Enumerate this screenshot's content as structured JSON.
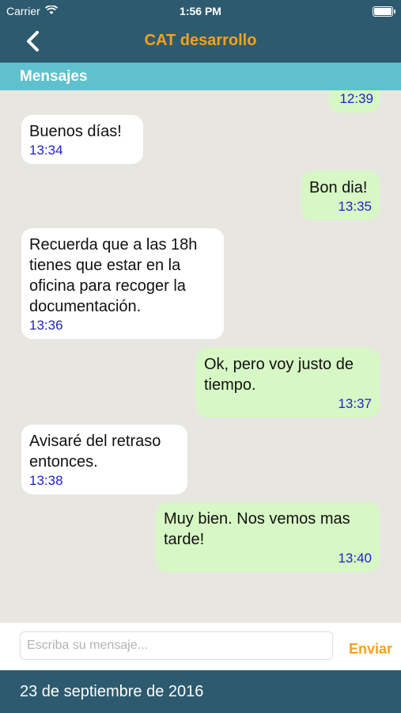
{
  "status_bar": {
    "carrier": "Carrier",
    "time": "1:56 PM"
  },
  "nav": {
    "title": "CAT desarrollo"
  },
  "section": {
    "label": "Mensajes"
  },
  "messages": [
    {
      "direction": "out",
      "text": "",
      "time": "12:39"
    },
    {
      "direction": "in",
      "text": "Buenos días!",
      "time": "13:34"
    },
    {
      "direction": "out",
      "text": "Bon dia!",
      "time": "13:35"
    },
    {
      "direction": "in",
      "text": "Recuerda que a las 18h tienes que estar en la oficina para recoger la documentación.",
      "time": "13:36"
    },
    {
      "direction": "out",
      "text": "Ok, pero voy justo de tiempo.",
      "time": "13:37"
    },
    {
      "direction": "in",
      "text": "Avisaré del retraso entonces.",
      "time": "13:38"
    },
    {
      "direction": "out",
      "text": "Muy bien. Nos vemos mas tarde!",
      "time": "13:40"
    }
  ],
  "composer": {
    "placeholder": "Escriba su mensaje...",
    "value": "",
    "send_label": "Enviar"
  },
  "footer": {
    "date": "23 de septiembre de 2016"
  },
  "colors": {
    "header": "#2d5a6e",
    "section_bar": "#5fc1cd",
    "accent": "#f5a21b",
    "incoming_bubble": "#ffffff",
    "outgoing_bubble": "#d7f7c4",
    "timestamp": "#2222cc",
    "chat_background": "#e8e6e1"
  }
}
